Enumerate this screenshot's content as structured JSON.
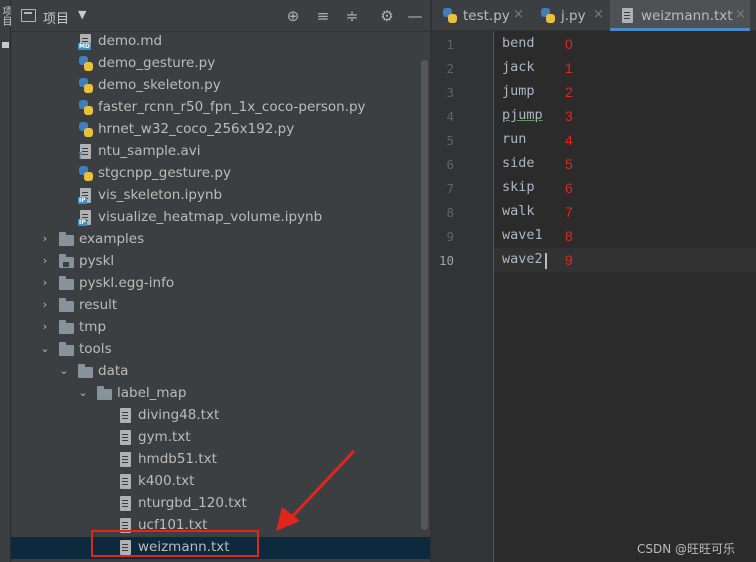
{
  "sidebar_strip": {
    "label": "项目"
  },
  "project": {
    "title": "项目",
    "caret": "▼",
    "tools": [
      "⊕",
      "≡",
      "≑",
      "⚙",
      "—"
    ]
  },
  "tree": [
    {
      "name": "demo.md",
      "icon": "markdown-file-icon",
      "badge": "MD"
    },
    {
      "name": "demo_gesture.py",
      "icon": "python-file-icon"
    },
    {
      "name": "demo_skeleton.py",
      "icon": "python-file-icon"
    },
    {
      "name": "faster_rcnn_r50_fpn_1x_coco-person.py",
      "icon": "python-file-icon"
    },
    {
      "name": "hrnet_w32_coco_256x192.py",
      "icon": "python-file-icon"
    },
    {
      "name": "ntu_sample.avi",
      "icon": "unknown-file-icon"
    },
    {
      "name": "stgcnpp_gesture.py",
      "icon": "python-file-icon"
    },
    {
      "name": "vis_skeleton.ipynb",
      "icon": "notebook-file-icon",
      "badge": "IP"
    },
    {
      "name": "visualize_heatmap_volume.ipynb",
      "icon": "notebook-file-icon",
      "badge": "IP"
    },
    {
      "name": "examples",
      "icon": "folder-icon",
      "arrow": "›"
    },
    {
      "name": "pyskl",
      "icon": "package-folder-icon",
      "arrow": "›"
    },
    {
      "name": "pyskl.egg-info",
      "icon": "folder-icon",
      "arrow": "›"
    },
    {
      "name": "result",
      "icon": "folder-icon",
      "arrow": "›"
    },
    {
      "name": "tmp",
      "icon": "folder-icon",
      "arrow": "›"
    },
    {
      "name": "tools",
      "icon": "folder-icon",
      "arrow": "⌄"
    },
    {
      "name": "data",
      "icon": "folder-icon",
      "arrow": "⌄"
    },
    {
      "name": "label_map",
      "icon": "folder-icon",
      "arrow": "⌄"
    },
    {
      "name": "diving48.txt",
      "icon": "text-file-icon"
    },
    {
      "name": "gym.txt",
      "icon": "text-file-icon"
    },
    {
      "name": "hmdb51.txt",
      "icon": "text-file-icon"
    },
    {
      "name": "k400.txt",
      "icon": "text-file-icon"
    },
    {
      "name": "nturgbd_120.txt",
      "icon": "text-file-icon"
    },
    {
      "name": "ucf101.txt",
      "icon": "text-file-icon"
    },
    {
      "name": "weizmann.txt",
      "icon": "text-file-icon",
      "selected": true
    }
  ],
  "tabs": [
    {
      "label": "test.py",
      "close": "×",
      "icon": "python-file-icon"
    },
    {
      "label": "j.py",
      "close": "×",
      "icon": "python-file-icon"
    },
    {
      "label": "weizmann.txt",
      "close": "×",
      "icon": "text-file-icon",
      "active": true
    }
  ],
  "editor": {
    "lines": [
      {
        "num": "1",
        "text": "bend",
        "note": "0"
      },
      {
        "num": "2",
        "text": "jack",
        "note": "1"
      },
      {
        "num": "3",
        "text": "jump",
        "note": "2"
      },
      {
        "num": "4",
        "text": "pjump",
        "note": "3",
        "underline": true
      },
      {
        "num": "5",
        "text": "run",
        "note": "4"
      },
      {
        "num": "6",
        "text": "side",
        "note": "5"
      },
      {
        "num": "7",
        "text": "skip",
        "note": "6"
      },
      {
        "num": "8",
        "text": "walk",
        "note": "7"
      },
      {
        "num": "9",
        "text": "wave1",
        "note": "8"
      },
      {
        "num": "10",
        "text": "wave2",
        "note": "9",
        "current": true
      }
    ]
  },
  "watermark": "CSDN @旺旺可乐",
  "colors": {
    "annotation": "#e0261b",
    "selection": "#0d293e",
    "active_tab_underline": "#4a88c7"
  }
}
